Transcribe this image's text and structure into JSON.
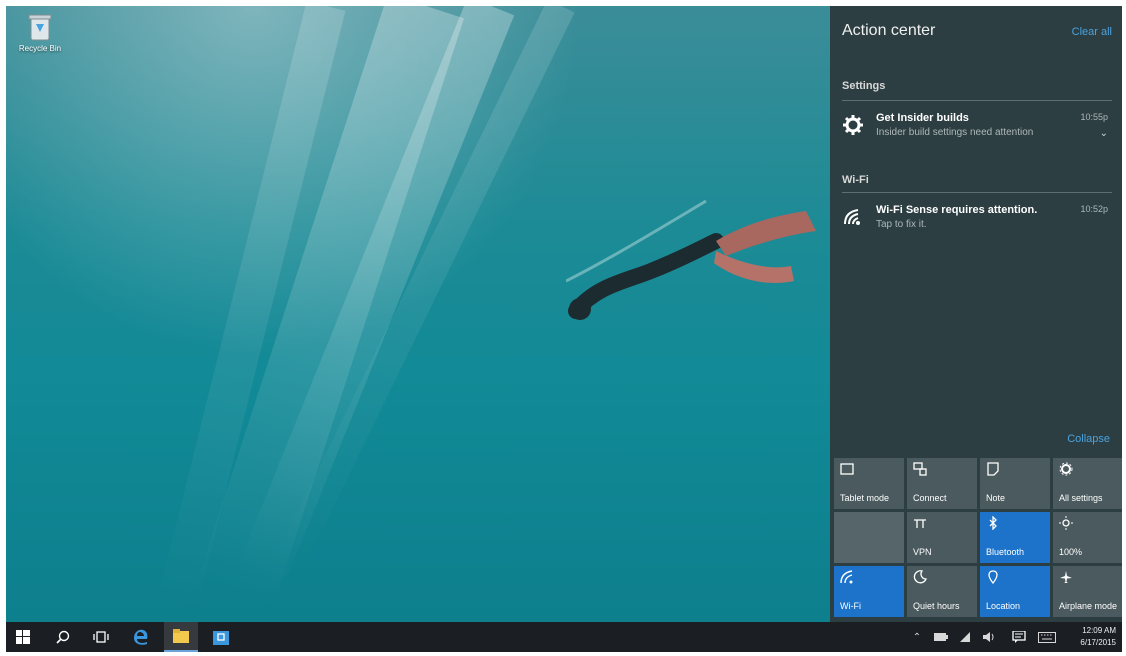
{
  "desktop": {
    "recycle_bin_label": "Recycle Bin"
  },
  "action_center": {
    "title": "Action center",
    "clear_all_label": "Clear all",
    "collapse_label": "Collapse",
    "groups": [
      {
        "label": "Settings",
        "notifications": [
          {
            "icon": "gear-icon",
            "title": "Get Insider builds",
            "body": "Insider build settings need attention",
            "time": "10:55p"
          }
        ]
      },
      {
        "label": "Wi-Fi",
        "notifications": [
          {
            "icon": "wifi-sense-icon",
            "title": "Wi-Fi Sense requires attention.",
            "body": "Tap to fix it.",
            "time": "10:52p"
          }
        ]
      }
    ],
    "quick_actions": [
      {
        "label": "Tablet mode",
        "icon": "tablet-mode-icon",
        "state": "off"
      },
      {
        "label": "Connect",
        "icon": "connect-icon",
        "state": "off"
      },
      {
        "label": "Note",
        "icon": "note-icon",
        "state": "off"
      },
      {
        "label": "All settings",
        "icon": "gear-icon",
        "state": "off"
      },
      {
        "label": "",
        "icon": "",
        "state": "disabled"
      },
      {
        "label": "VPN",
        "icon": "vpn-icon",
        "state": "off"
      },
      {
        "label": "Bluetooth",
        "icon": "bluetooth-icon",
        "state": "on"
      },
      {
        "label": "100%",
        "icon": "brightness-icon",
        "state": "off"
      },
      {
        "label": "Wi-Fi",
        "icon": "wifi-icon",
        "state": "on"
      },
      {
        "label": "Quiet hours",
        "icon": "moon-icon",
        "state": "off"
      },
      {
        "label": "Location",
        "icon": "location-icon",
        "state": "on"
      },
      {
        "label": "Airplane mode",
        "icon": "airplane-icon",
        "state": "off"
      }
    ]
  },
  "taskbar": {
    "clock_time": "12:09 AM",
    "clock_date": "6/17/2015"
  },
  "colors": {
    "accent": "#1d73c9",
    "action_center_bg": "#2c3e42",
    "taskbar_bg": "#1b1f24",
    "tile_off": "#4b5a5e",
    "link": "#4aa3df"
  }
}
